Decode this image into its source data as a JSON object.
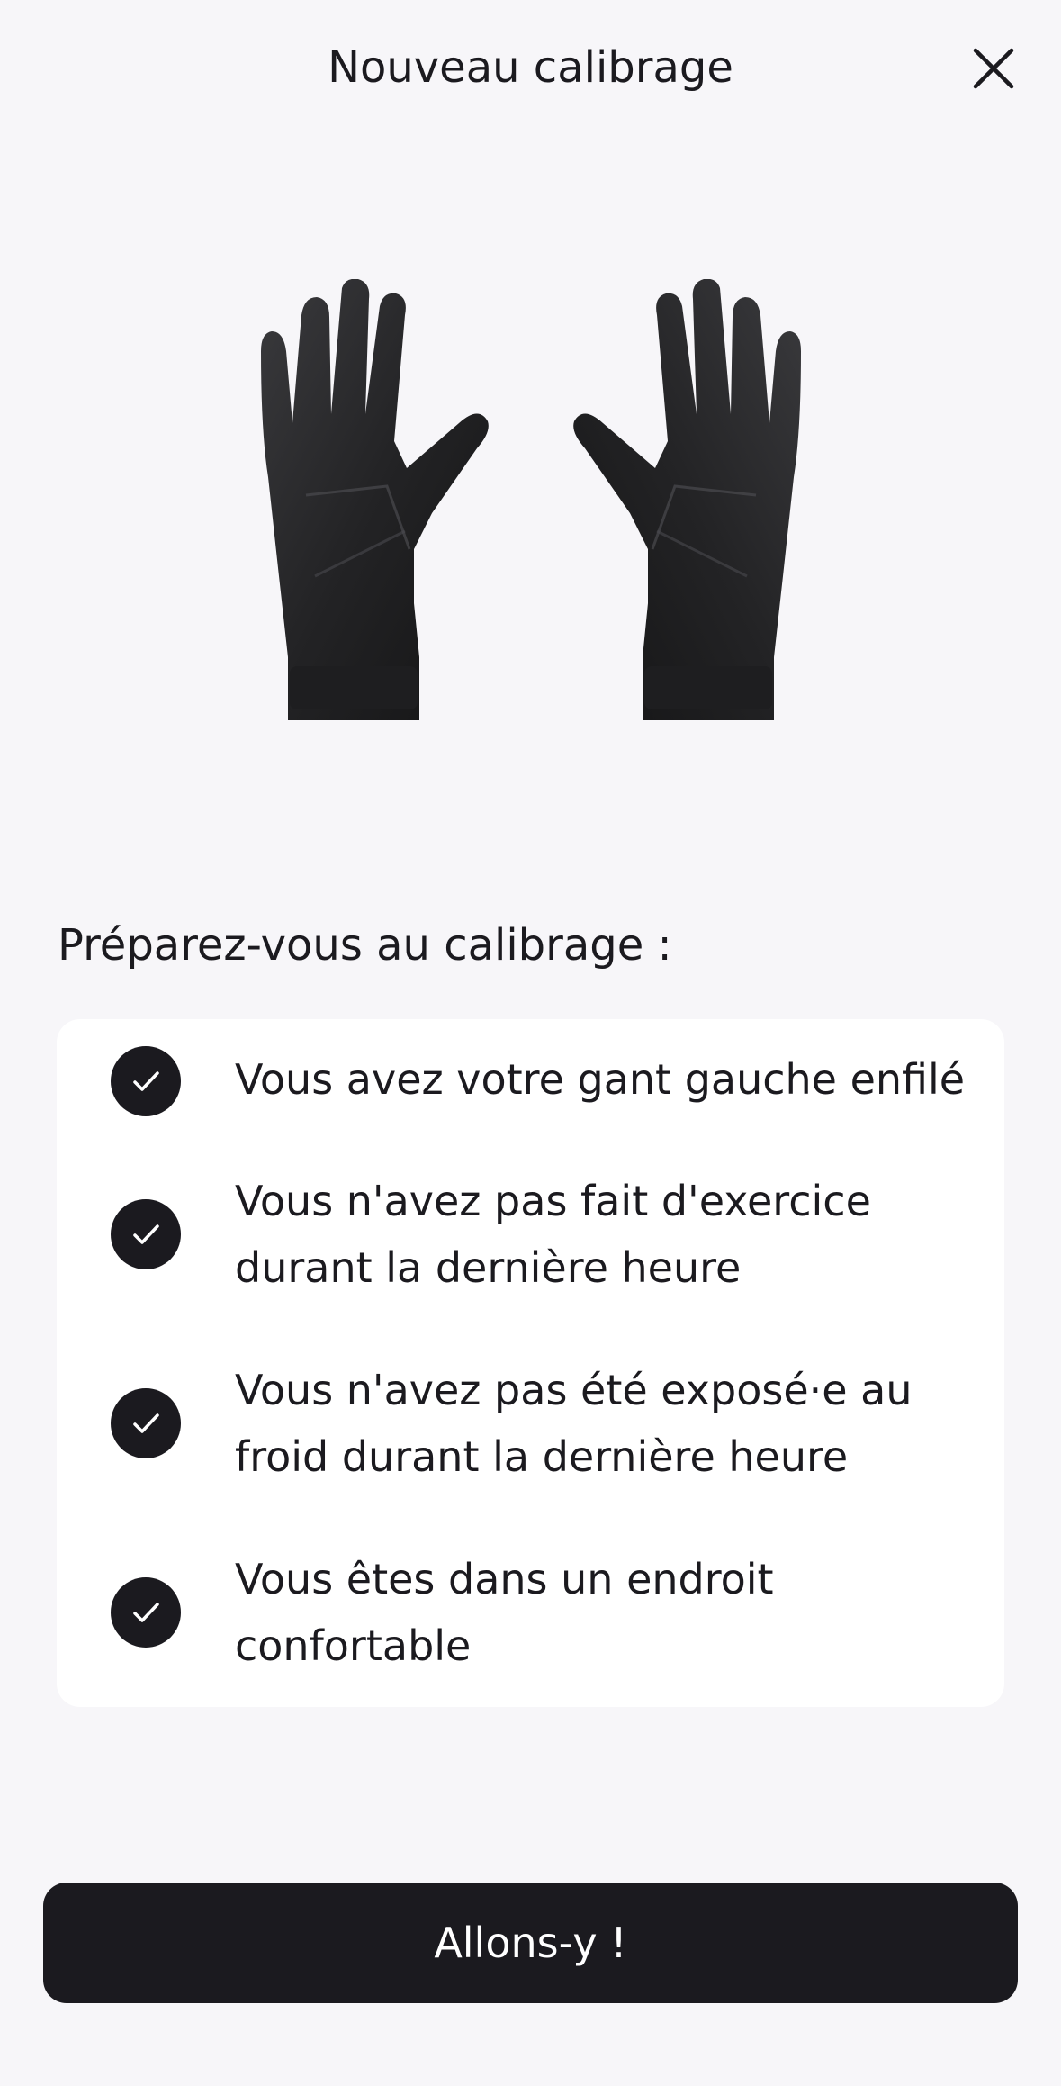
{
  "header": {
    "title": "Nouveau calibrage",
    "close_icon": "close-icon"
  },
  "illustration": {
    "icon": "gloves-illustration"
  },
  "checklist": {
    "title": "Préparez-vous au calibrage :",
    "items": [
      {
        "icon": "check-circle-icon",
        "line1": "Vous avez votre gant gauche enfilé",
        "line2": ""
      },
      {
        "icon": "check-circle-icon",
        "line1": "Vous n'avez pas fait d'exercice",
        "line2": "durant la dernière heure"
      },
      {
        "icon": "check-circle-icon",
        "line1": "Vous n'avez pas été exposé·e au",
        "line2": "froid durant la dernière heure"
      },
      {
        "icon": "check-circle-icon",
        "line1": "Vous êtes dans un endroit",
        "line2": "confortable"
      }
    ]
  },
  "footer": {
    "button_label": "Allons-y !"
  },
  "colors": {
    "background": "#f7f6f9",
    "card": "#ffffff",
    "primary": "#1b1a1f",
    "on_primary": "#ffffff"
  }
}
